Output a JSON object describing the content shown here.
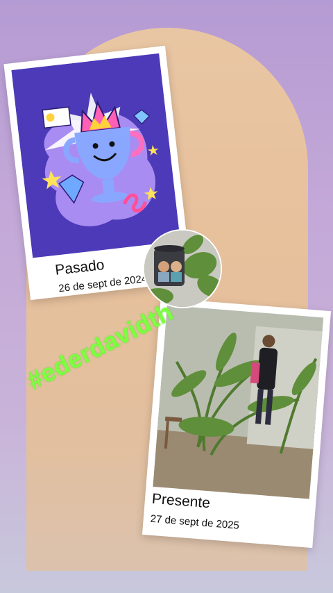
{
  "past_card": {
    "title": "Pasado",
    "date": "26 de sept de 2024"
  },
  "present_card": {
    "title": "Presente",
    "date": "27 de sept de 2025"
  },
  "hashtag": "#ederdavidth",
  "stickers": {
    "past_illustration": "trophy-illustration-icon",
    "circle_photo": "plant-mug-photo"
  },
  "colors": {
    "background_top": "#b59bd3",
    "arch": "#e7c09c",
    "past_photo_bg": "#4c3ab8",
    "hashtag": "#7cff3f"
  }
}
